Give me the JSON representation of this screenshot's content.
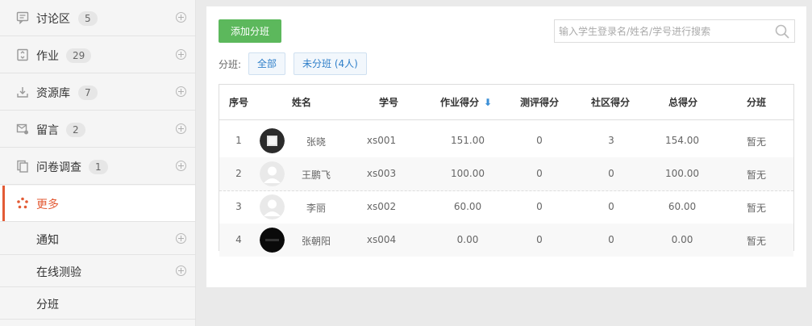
{
  "sidebar": {
    "items": [
      {
        "label": "讨论区",
        "badge": "5",
        "icon": "comment-icon"
      },
      {
        "label": "作业",
        "badge": "29",
        "icon": "assignment-icon"
      },
      {
        "label": "资源库",
        "badge": "7",
        "icon": "download-icon"
      },
      {
        "label": "留言",
        "badge": "2",
        "icon": "message-icon"
      },
      {
        "label": "问卷调查",
        "badge": "1",
        "icon": "survey-icon"
      },
      {
        "label": "更多",
        "icon": "more-icon"
      }
    ],
    "sub_items": [
      {
        "label": "通知"
      },
      {
        "label": "在线测验"
      },
      {
        "label": "分班"
      }
    ],
    "active_color": "#e35b35"
  },
  "toolbar": {
    "add_label": "添加分班",
    "add_color": "#5cb85c",
    "search_placeholder": "输入学生登录名/姓名/学号进行搜索"
  },
  "filter": {
    "label": "分班:",
    "chips": [
      "全部",
      "未分班 (4人)"
    ]
  },
  "table": {
    "columns": [
      "序号",
      "姓名",
      "学号",
      "作业得分",
      "测评得分",
      "社区得分",
      "总得分",
      "分班"
    ],
    "sort_indicator": "⬇",
    "rows": [
      {
        "index": "1",
        "avatar": "dark-square",
        "name": "张晓",
        "id": "xs001",
        "homework": "151.00",
        "assessment": "0",
        "community": "3",
        "total": "154.00",
        "group": "暂无"
      },
      {
        "index": "2",
        "avatar": "default",
        "name": "王鹏飞",
        "id": "xs003",
        "homework": "100.00",
        "assessment": "0",
        "community": "0",
        "total": "100.00",
        "group": "暂无"
      },
      {
        "index": "3",
        "avatar": "default",
        "name": "李丽",
        "id": "xs002",
        "homework": "60.00",
        "assessment": "0",
        "community": "0",
        "total": "60.00",
        "group": "暂无"
      },
      {
        "index": "4",
        "avatar": "black",
        "name": "张朝阳",
        "id": "xs004",
        "homework": "0.00",
        "assessment": "0",
        "community": "0",
        "total": "0.00",
        "group": "暂无"
      }
    ]
  }
}
